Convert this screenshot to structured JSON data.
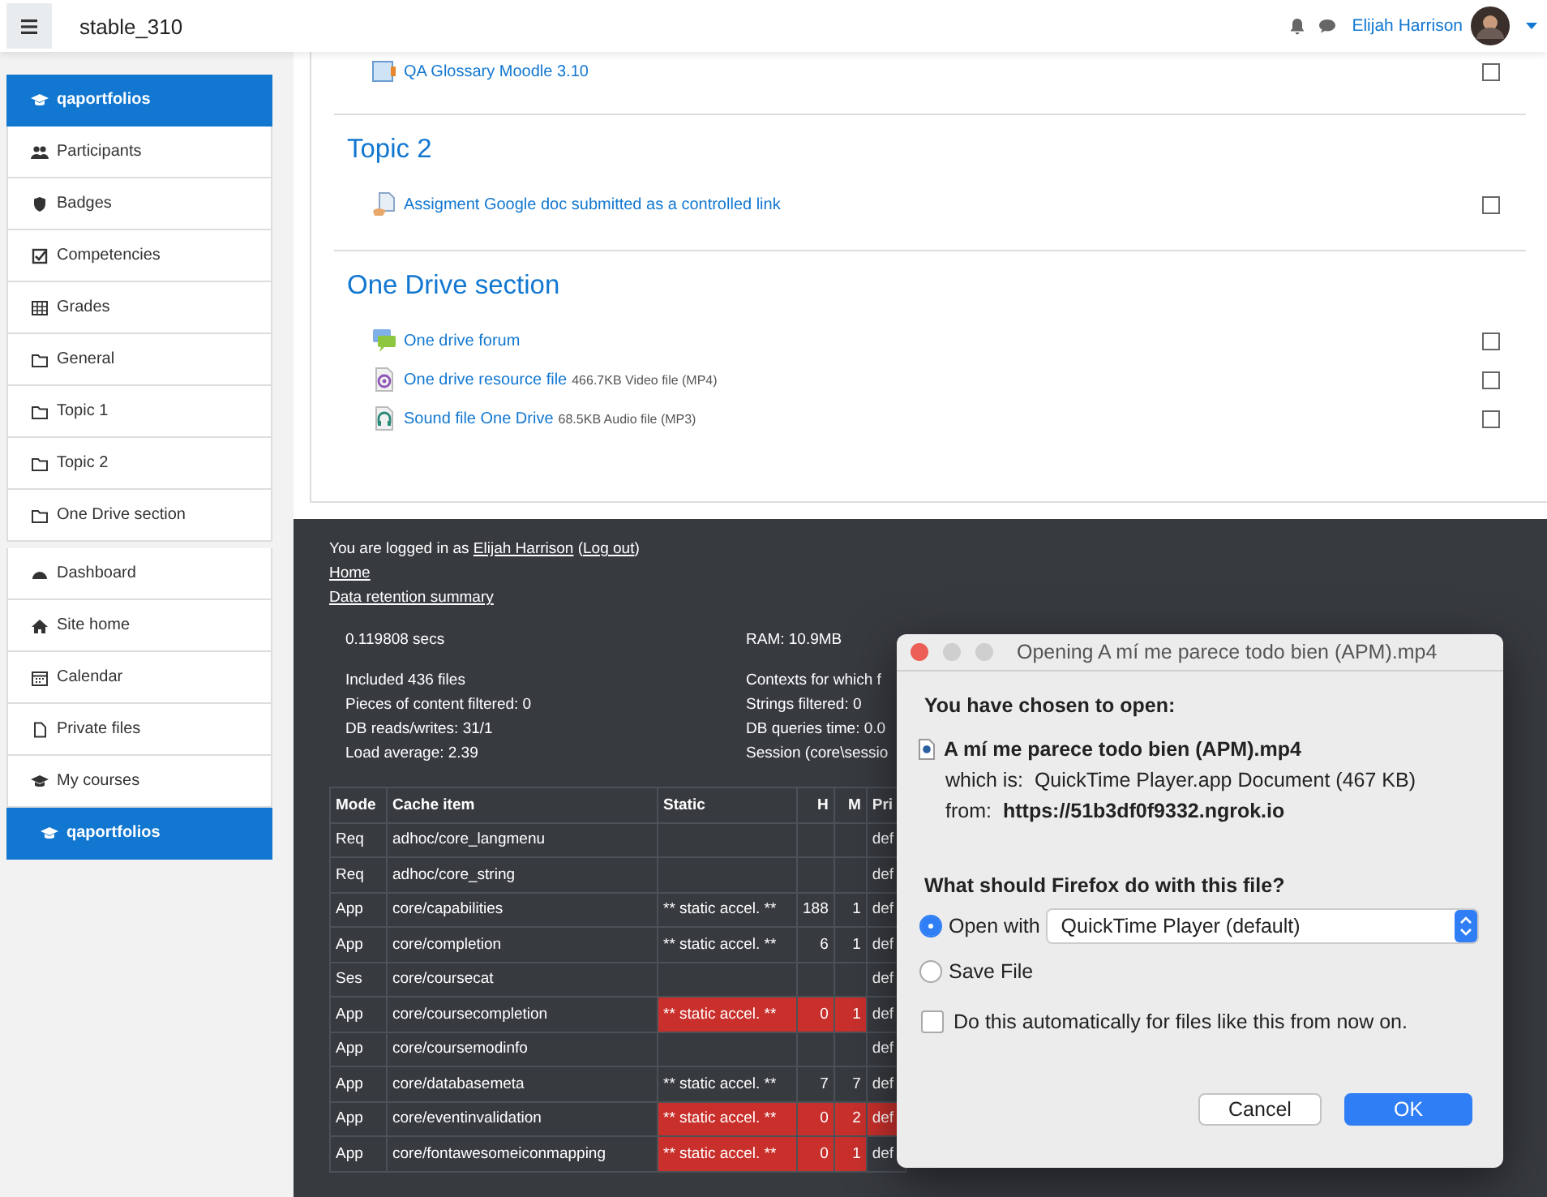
{
  "header": {
    "site_name": "stable_310",
    "user_name": "Elijah Harrison"
  },
  "sidebar": {
    "items": [
      {
        "label": "qaportfolios",
        "kind": "course",
        "selected": true
      },
      {
        "label": "Participants",
        "kind": "users",
        "selected": false
      },
      {
        "label": "Badges",
        "kind": "shield",
        "selected": false
      },
      {
        "label": "Competencies",
        "kind": "check",
        "selected": false
      },
      {
        "label": "Grades",
        "kind": "table",
        "selected": false
      },
      {
        "label": "General",
        "kind": "folder",
        "selected": false
      },
      {
        "label": "Topic 1",
        "kind": "folder",
        "selected": false
      },
      {
        "label": "Topic 2",
        "kind": "folder",
        "selected": false
      },
      {
        "label": "One Drive section",
        "kind": "folder",
        "selected": false,
        "gap_after": true
      },
      {
        "label": "Dashboard",
        "kind": "dashboard",
        "selected": false
      },
      {
        "label": "Site home",
        "kind": "home",
        "selected": false
      },
      {
        "label": "Calendar",
        "kind": "calendar",
        "selected": false
      },
      {
        "label": "Private files",
        "kind": "file",
        "selected": false
      },
      {
        "label": "My courses",
        "kind": "course",
        "selected": false
      },
      {
        "label": "qaportfolios",
        "kind": "course",
        "selected": true,
        "indent": true
      }
    ]
  },
  "course": {
    "sections": [
      {
        "activities": [
          {
            "name": "QA Glossary Moodle 3.10",
            "kind": "glossary",
            "completed": false
          }
        ]
      },
      {
        "title": "Topic 2",
        "activities": [
          {
            "name": "Assigment Google doc submitted as a controlled link",
            "kind": "assignment",
            "completed": false
          }
        ]
      },
      {
        "title": "One Drive section",
        "activities": [
          {
            "name": "One drive forum",
            "kind": "forum",
            "completed": false
          },
          {
            "name": "One drive resource file",
            "details": "466.7KB Video file (MP4)",
            "kind": "video",
            "completed": false
          },
          {
            "name": "Sound file One Drive",
            "details": "68.5KB Audio file (MP3)",
            "kind": "audio",
            "completed": false
          }
        ]
      }
    ]
  },
  "footer": {
    "logged_in_prefix": "You are logged in as",
    "user_link": "Elijah Harrison",
    "logout_link": "Log out",
    "open_paren": "(",
    "close_paren": ")",
    "links": [
      "Home",
      "Data retention summary"
    ],
    "stats_left": [
      "0.119808 secs",
      "Included 436 files",
      "Pieces of content filtered: 0",
      "DB reads/writes: 31/1",
      "Load average: 2.39"
    ],
    "stats_right": [
      "RAM: 10.9MB",
      "Contexts for which f",
      "Strings filtered: 0",
      "DB queries time: 0.0",
      "Session (core\\sessio"
    ],
    "cache_table": {
      "columns": [
        "Mode",
        "Cache item",
        "Static",
        "H",
        "M",
        "Pri"
      ],
      "rows": [
        {
          "mode": "Req",
          "item": "adhoc/core_langmenu",
          "pri": "def",
          "warn": false,
          "pri_warn": false
        },
        {
          "mode": "Req",
          "item": "adhoc/core_string",
          "pri": "def",
          "warn": false,
          "pri_warn": false
        },
        {
          "mode": "App",
          "item": "core/capabilities",
          "static": "** static accel. **",
          "h": "188",
          "m": "1",
          "pri": "def",
          "warn": false,
          "pri_warn": false
        },
        {
          "mode": "App",
          "item": "core/completion",
          "static": "** static accel. **",
          "h": "6",
          "m": "1",
          "pri": "def",
          "warn": false,
          "pri_warn": false
        },
        {
          "mode": "Ses",
          "item": "core/coursecat",
          "pri": "def",
          "warn": false,
          "pri_warn": false
        },
        {
          "mode": "App",
          "item": "core/coursecompletion",
          "static": "** static accel. **",
          "h": "0",
          "m": "1",
          "pri": "def",
          "warn": true,
          "pri_warn": false
        },
        {
          "mode": "App",
          "item": "core/coursemodinfo",
          "pri": "def",
          "warn": false,
          "pri_warn": false
        },
        {
          "mode": "App",
          "item": "core/databasemeta",
          "static": "** static accel. **",
          "h": "7",
          "m": "7",
          "pri": "def",
          "warn": false,
          "pri_warn": false
        },
        {
          "mode": "App",
          "item": "core/eventinvalidation",
          "static": "** static accel. **",
          "h": "0",
          "m": "2",
          "pri": "def",
          "warn": true,
          "pri_warn": true
        },
        {
          "mode": "App",
          "item": "core/fontawesomeiconmapping",
          "static": "** static accel. **",
          "h": "0",
          "m": "1",
          "pri": "def",
          "warn": true,
          "pri_warn": false
        }
      ]
    }
  },
  "dialog": {
    "title": "Opening A mí me parece todo bien (APM).mp4",
    "heading": "You have chosen to open:",
    "file_name": "A mí me parece todo bien (APM).mp4",
    "which_is_label": "which is:",
    "which_is": "QuickTime Player.app Document (467 KB)",
    "from_label": "from:",
    "from": "https://51b3df0f9332.ngrok.io",
    "question": "What should Firefox do with this file?",
    "options": [
      {
        "label": "Open with",
        "selected": true
      },
      {
        "label": "Save File",
        "selected": false
      }
    ],
    "app_select": "QuickTime Player (default)",
    "auto_checkbox": {
      "label": "Do this automatically for files like this from now on.",
      "checked": false
    },
    "buttons": [
      {
        "label": "Cancel",
        "default": false
      },
      {
        "label": "OK",
        "default": true
      }
    ]
  }
}
